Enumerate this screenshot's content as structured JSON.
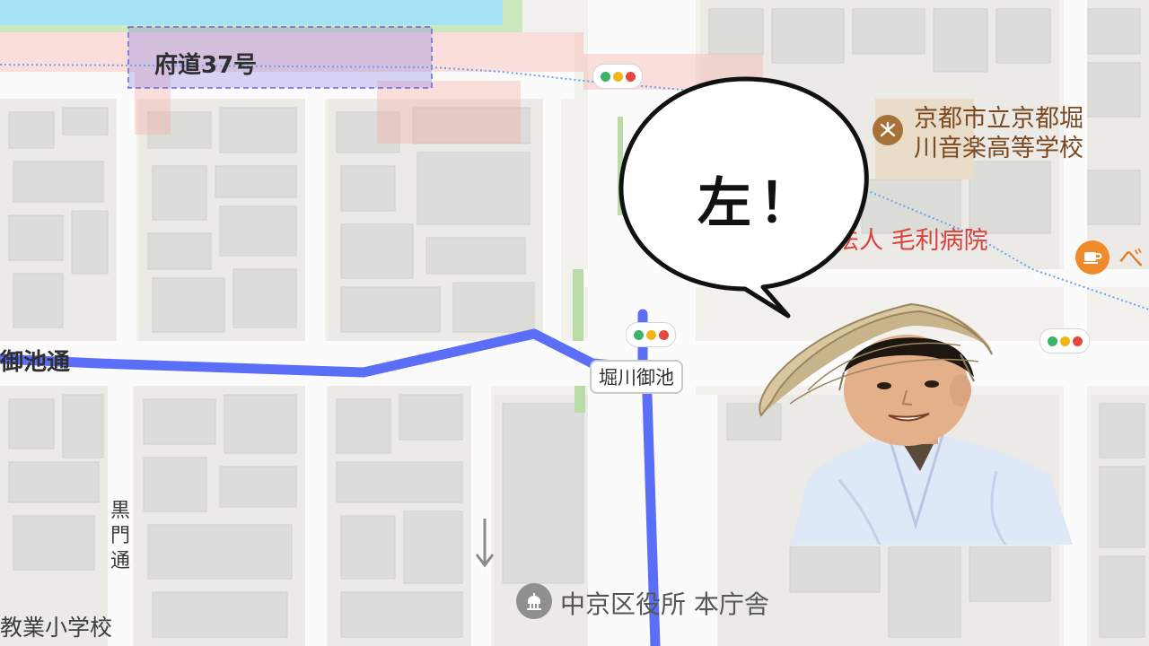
{
  "map": {
    "road_labels": {
      "prefectural_road": "府道37号",
      "oike_dori_partial": "御池通",
      "kuromon_dori": [
        "黒",
        "門",
        "通"
      ],
      "school_partial": "教業小学校"
    },
    "intersection_label": "堀川御池",
    "poi": {
      "school_name_line1": "京都市立京都堀",
      "school_name_line2": "川音楽高等学校",
      "hospital_name": "法人 毛利病院",
      "cafe_partial": "べ",
      "ward_office": "中京区役所 本庁舎"
    },
    "icons": {
      "school": "school-icon",
      "cafe": "cafe-icon",
      "government": "government-building-icon",
      "traffic_light": "traffic-light-icon",
      "one_way": "one-way-arrow-icon"
    },
    "colors": {
      "route": "#5b6ef7",
      "water": "#a6e2f5",
      "park": "#cde8bf",
      "road": "#fbfbfb",
      "building": "#dededa",
      "hospital_text": "#d8433b",
      "school_badge": "#a77238",
      "cafe_badge": "#f08b2b"
    }
  },
  "overlay": {
    "speech_text": "左！"
  }
}
